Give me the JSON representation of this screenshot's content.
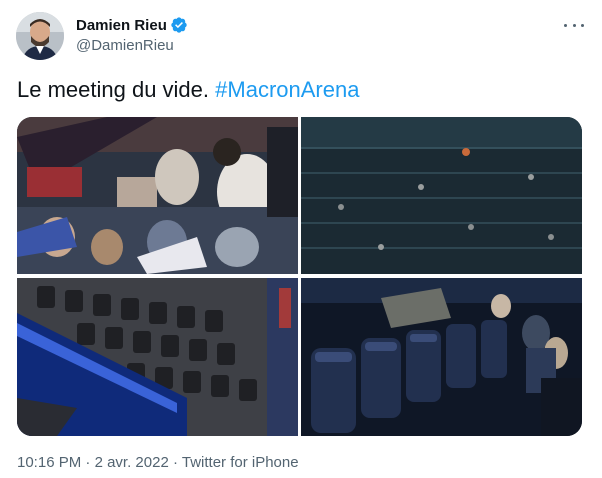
{
  "tweet": {
    "author": {
      "display_name": "Damien Rieu",
      "handle": "@DamienRieu",
      "verified": true,
      "verified_icon": "verified-badge-icon"
    },
    "text": "Le meeting du vide. ",
    "hashtag": "#MacronArena",
    "time": "10:16 PM",
    "separator": " · ",
    "date": "2 avr. 2022",
    "source": "Twitter for iPhone",
    "media_count": 4
  },
  "colors": {
    "link": "#1d9bf0",
    "secondary_text": "#536471",
    "primary_text": "#0f1419",
    "verified": "#1d9bf0"
  }
}
